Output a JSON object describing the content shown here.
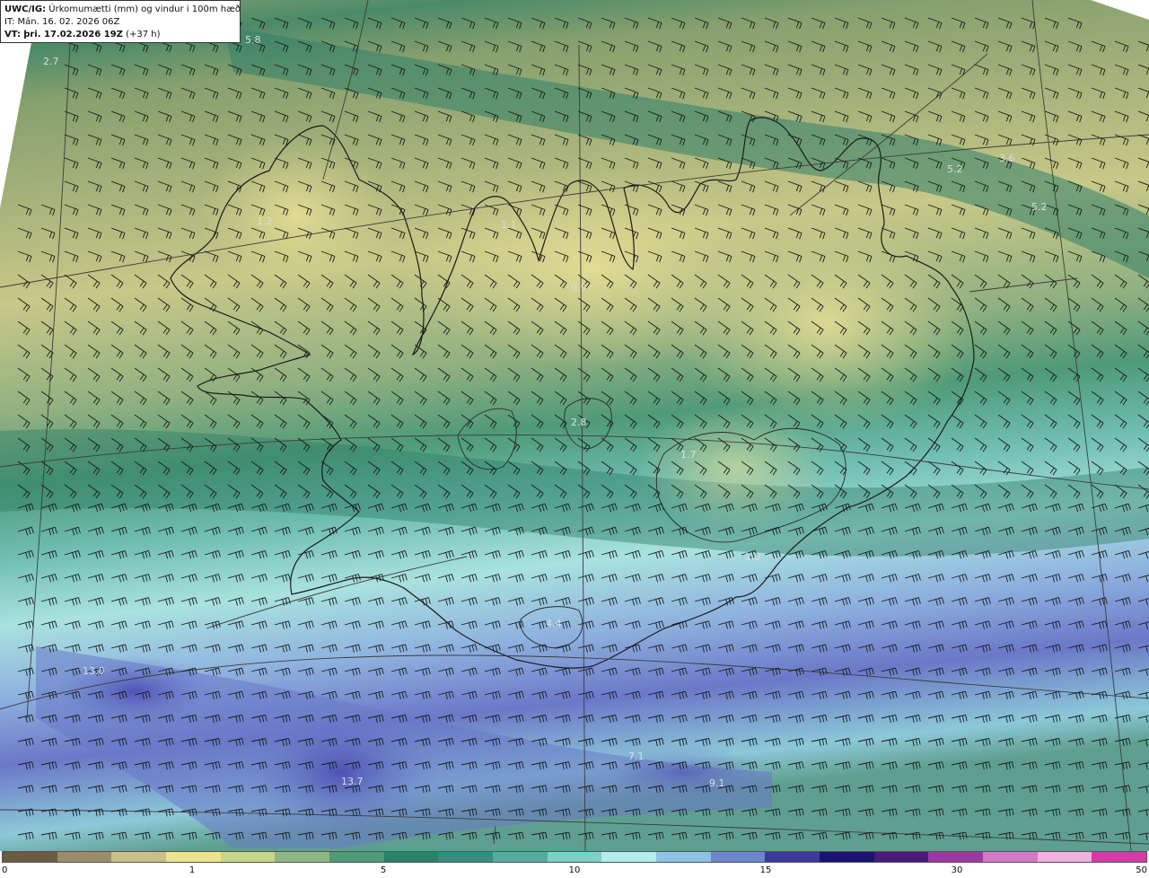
{
  "header": {
    "model": "UWC/IG:",
    "parameter": "Úrkomumætti (mm) og vindur i 100m hæð",
    "it_label": "IT:",
    "it_value": "Mán. 16. 02. 2026 06Z",
    "vt_label": "VT:",
    "vt_value": "þri. 17.02.2026 19Z",
    "vt_offset": "(+37 h)"
  },
  "map_labels": [
    {
      "text": "5.8"
    },
    {
      "text": "2.7"
    },
    {
      "text": "5.2"
    },
    {
      "text": "3.6"
    },
    {
      "text": "5.2"
    },
    {
      "text": "1.1"
    },
    {
      "text": "0.9"
    },
    {
      "text": "1.2"
    },
    {
      "text": "2.8"
    },
    {
      "text": "1.7"
    },
    {
      "text": "2.8"
    },
    {
      "text": "4.4"
    },
    {
      "text": "13.0"
    },
    {
      "text": "13.7"
    },
    {
      "text": "7.1"
    },
    {
      "text": "9.1"
    }
  ],
  "colorbar": {
    "ticks": [
      "0",
      "1",
      "5",
      "10",
      "15",
      "30",
      "50"
    ],
    "colors": [
      "#6b5a44",
      "#9a8b6a",
      "#c9c08a",
      "#ece48f",
      "#c6d68a",
      "#8fb784",
      "#4f9a78",
      "#2f7f69",
      "#3a8b80",
      "#5aa9a0",
      "#7fcfc8",
      "#b3ecec",
      "#8fc3e6",
      "#6a86cc",
      "#3a3aa0",
      "#1a1470",
      "#4a1b7a",
      "#9a3aa0",
      "#d27ac8",
      "#f0b0e0",
      "#d43aa8"
    ]
  },
  "map_colors": {
    "land_line": "#1a1a1a",
    "grid_line": "#3c3c3c",
    "barb": "#1a1a1a"
  }
}
